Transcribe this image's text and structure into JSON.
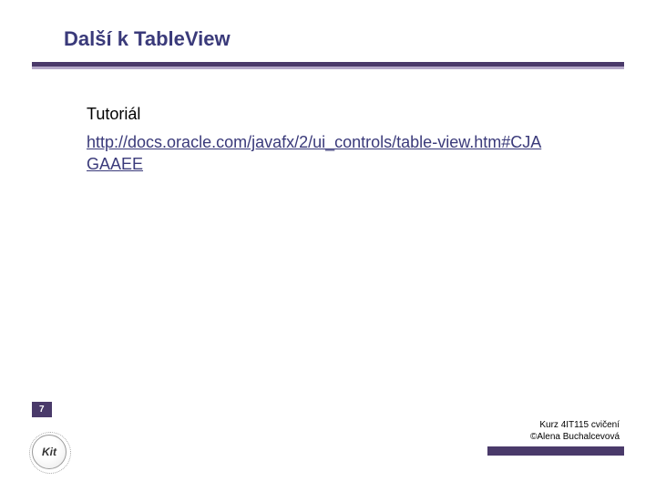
{
  "slide": {
    "title": "Další k TableView",
    "tutorial_label": "Tutoriál",
    "tutorial_link": "http://docs.oracle.com/javafx/2/ui_controls/table-view.htm#CJAGAAEE",
    "page_number": "7",
    "footer_line1": "Kurz 4IT115 cvičení",
    "footer_line2": "©Alena Buchalcevová",
    "logo_text": "Kit"
  }
}
